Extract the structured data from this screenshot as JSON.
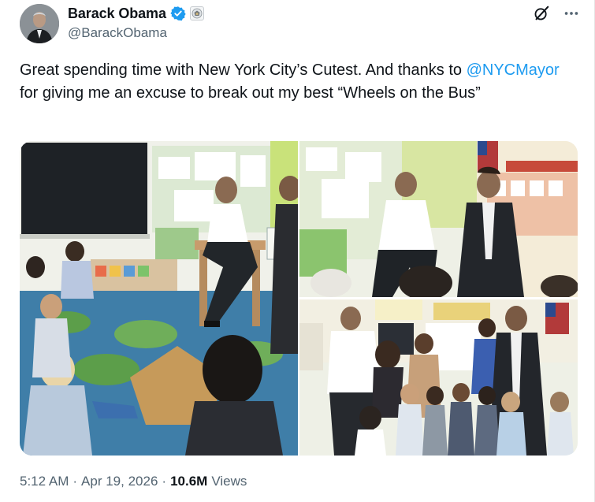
{
  "author": {
    "display_name": "Barack Obama",
    "handle": "@BarackObama",
    "verified_color": "#1d9bf0",
    "avatar_icon": "profile-photo"
  },
  "header_actions": {
    "grok_icon": "grok-slash-circle-icon",
    "more_icon": "more-horizontal-icon"
  },
  "tweet": {
    "text_part1": "Great spending time with New York City’s Cutest. And thanks to ",
    "mention": "@NYCMayor",
    "text_part2": " for giving me an excuse to break out my best “Wheels on the Bus”"
  },
  "media": {
    "count": 3
  },
  "meta": {
    "time": "5:12 AM",
    "separator1": "·",
    "date": "Apr 19, 2026",
    "separator2": "·",
    "views_count": "10.6M",
    "views_label": "Views"
  },
  "colors": {
    "link": "#1d9bf0",
    "secondary_text": "#536471",
    "primary_text": "#0f1419"
  }
}
